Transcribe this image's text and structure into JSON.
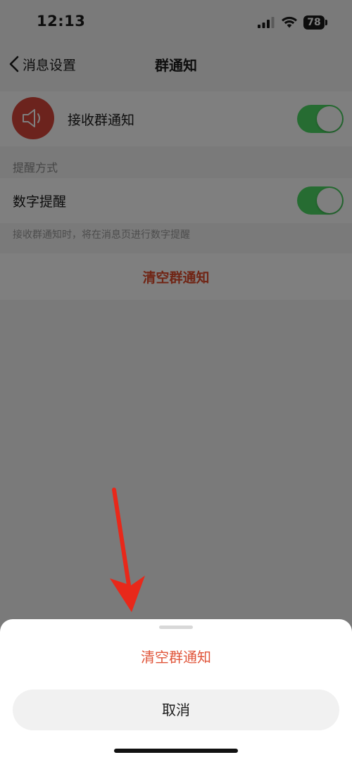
{
  "status_bar": {
    "time": "12:13",
    "battery": "78",
    "icons": [
      "cellular-signal-icon",
      "wifi-icon",
      "battery-icon"
    ]
  },
  "nav": {
    "back_label": "消息设置",
    "title": "群通知"
  },
  "settings": {
    "receive_label": "接收群通知",
    "receive_enabled": true,
    "section_header": "提醒方式",
    "digit_label": "数字提醒",
    "digit_enabled": true,
    "footnote": "接收群通知时，将在消息页进行数字提醒",
    "clear_label": "清空群通知"
  },
  "sheet": {
    "action_label": "清空群通知",
    "cancel_label": "取消"
  },
  "colors": {
    "accent_red": "#e04a2a",
    "toggle_on": "#4cd964",
    "avatar_red": "#d9473b",
    "annotation_arrow": "#e8281a"
  }
}
